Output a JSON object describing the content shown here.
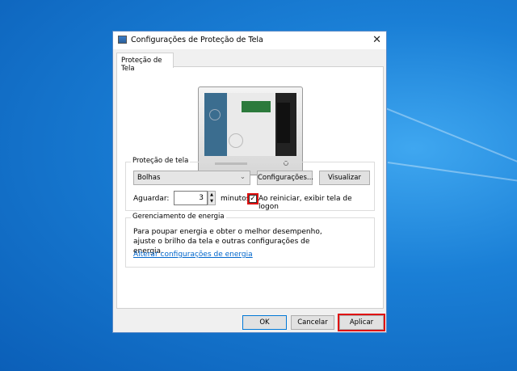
{
  "dialog": {
    "title": "Configurações de Proteção de Tela",
    "close": "✕",
    "tab": "Proteção de Tela"
  },
  "screensaver": {
    "group_label": "Proteção de tela",
    "selected": "Bolhas",
    "settings_button": "Configurações...",
    "preview_button": "Visualizar",
    "wait_label": "Aguardar:",
    "wait_value": "3",
    "minutes_label": "minutos",
    "logon_checkbox_label": "Ao reiniciar, exibir tela de logon",
    "logon_checked": true
  },
  "power": {
    "group_label": "Gerenciamento de energia",
    "description": "Para poupar energia e obter o melhor desempenho, ajuste o brilho da tela e outras configurações de energia.",
    "link": "Alterar configurações de energia"
  },
  "buttons": {
    "ok": "OK",
    "cancel": "Cancelar",
    "apply": "Aplicar"
  },
  "colors": {
    "highlight": "#e01010",
    "link": "#0066cc",
    "accent": "#0078d7"
  }
}
